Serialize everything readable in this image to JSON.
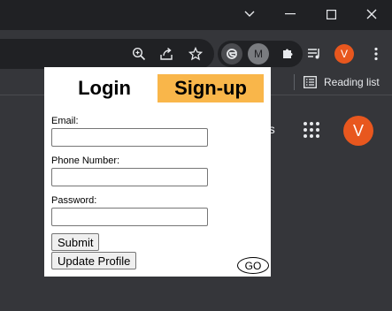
{
  "window": {
    "minimize_glyph": "—",
    "maximize_glyph": "☐",
    "close_glyph": "✕",
    "tab_search_glyph": "⌄"
  },
  "toolbar": {
    "extension_m_label": "M",
    "profile_initial": "V"
  },
  "bookmarks": {
    "reading_list_label": "Reading list"
  },
  "newtab": {
    "gmail_partial": "es",
    "profile_initial": "V"
  },
  "popup": {
    "tabs": {
      "login": "Login",
      "signup": "Sign-up"
    },
    "fields": {
      "email_label": "Email:",
      "email_value": "",
      "phone_label": "Phone Number:",
      "phone_value": "",
      "password_label": "Password:",
      "password_value": ""
    },
    "buttons": {
      "submit": "Submit",
      "update_profile": "Update Profile",
      "go": "GO"
    },
    "colors": {
      "signup_tab_bg": "#f9b64a"
    }
  },
  "colors": {
    "titlebar": "#202124",
    "chrome": "#35363a",
    "profile_avatar": "#e8571e"
  }
}
